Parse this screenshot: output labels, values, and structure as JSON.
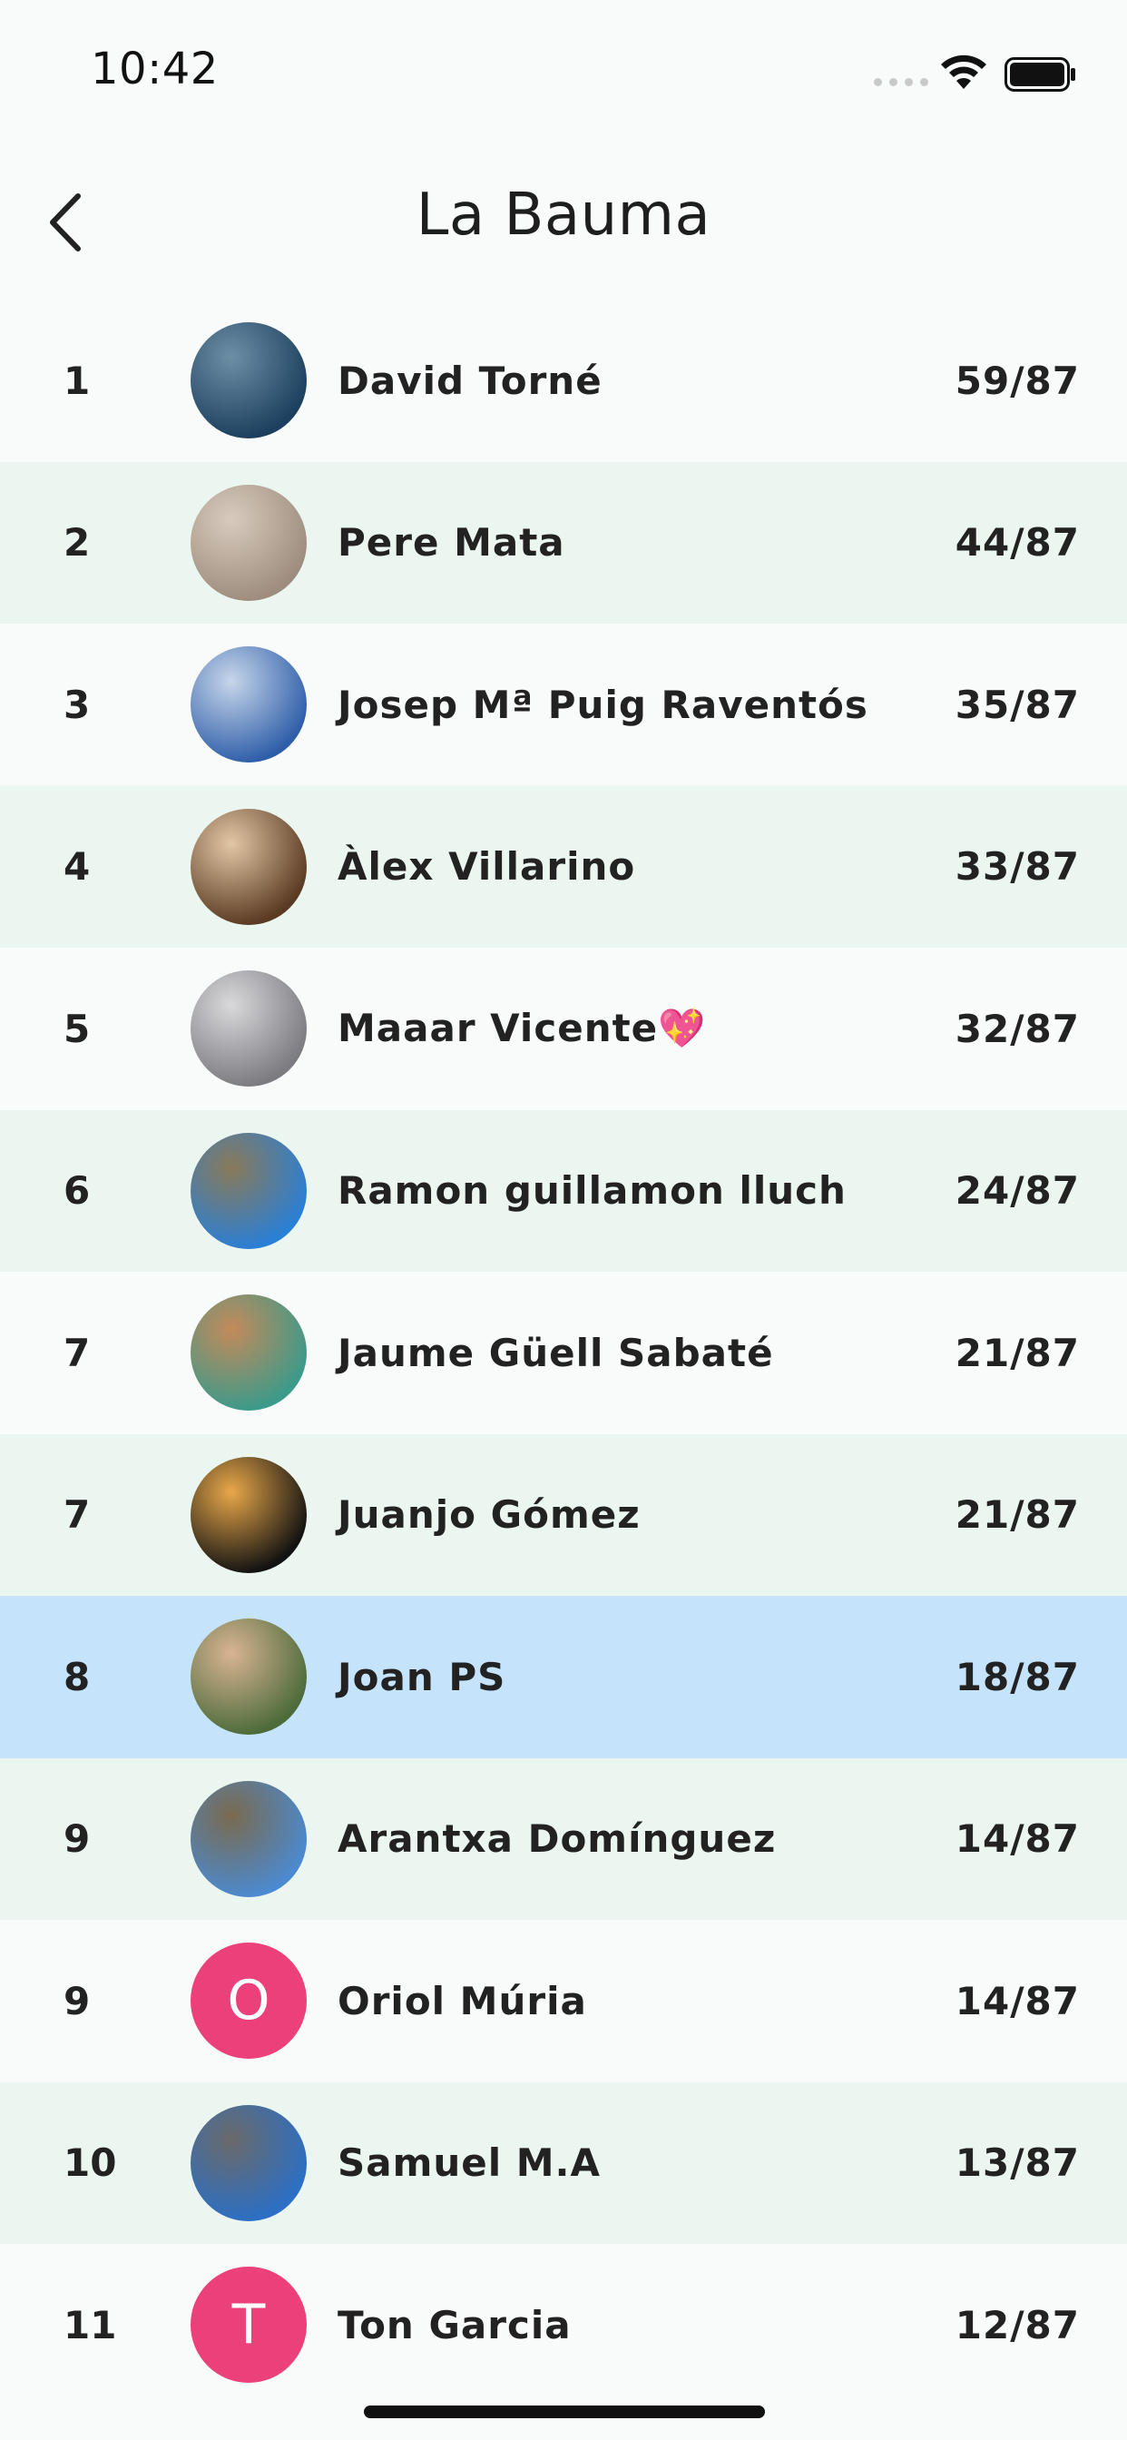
{
  "status_bar": {
    "time": "10:42"
  },
  "nav": {
    "title": "La Bauma"
  },
  "colors": {
    "avatar_letter_bg": "#ec407a",
    "highlight_row": "#c5e4fb",
    "alt_row": "#ecf6f1"
  },
  "rows": [
    {
      "rank": "1",
      "name": "David Torné",
      "score": "59/87",
      "avatar": "photo",
      "avatar_colors": [
        "#1c3f5e",
        "#6d8fa6"
      ]
    },
    {
      "rank": "2",
      "name": "Pere Mata",
      "score": "44/87",
      "avatar": "photo",
      "avatar_colors": [
        "#9e8d7e",
        "#d8cbbd"
      ]
    },
    {
      "rank": "3",
      "name": "Josep Mª Puig Raventós",
      "score": "35/87",
      "avatar": "photo",
      "avatar_colors": [
        "#2f5ea9",
        "#c7d6ea"
      ]
    },
    {
      "rank": "4",
      "name": "Àlex Villarino",
      "score": "33/87",
      "avatar": "photo",
      "avatar_colors": [
        "#5a3a22",
        "#e2c7a5"
      ]
    },
    {
      "rank": "5",
      "name": "Maaar Vicente💖",
      "score": "32/87",
      "avatar": "photo",
      "avatar_colors": [
        "#7b7b80",
        "#d9d9dc"
      ]
    },
    {
      "rank": "6",
      "name": "Ramon guillamon lluch",
      "score": "24/87",
      "avatar": "photo",
      "avatar_colors": [
        "#2a7fd6",
        "#8a7a58"
      ]
    },
    {
      "rank": "7",
      "name": "Jaume Güell Sabaté",
      "score": "21/87",
      "avatar": "photo",
      "avatar_colors": [
        "#3b9a8a",
        "#c48a5a"
      ]
    },
    {
      "rank": "7",
      "name": "Juanjo Gómez",
      "score": "21/87",
      "avatar": "photo",
      "avatar_colors": [
        "#121212",
        "#e8a84a"
      ]
    },
    {
      "rank": "8",
      "name": "Joan PS",
      "score": "18/87",
      "avatar": "photo",
      "avatar_colors": [
        "#4d6b3a",
        "#d8b493"
      ],
      "highlight": true
    },
    {
      "rank": "9",
      "name": "Arantxa Domínguez",
      "score": "14/87",
      "avatar": "photo",
      "avatar_colors": [
        "#4b8ad0",
        "#7a6a4e"
      ]
    },
    {
      "rank": "9",
      "name": "Oriol Múria",
      "score": "14/87",
      "avatar": "letter",
      "letter": "O"
    },
    {
      "rank": "10",
      "name": "Samuel M.A",
      "score": "13/87",
      "avatar": "photo",
      "avatar_colors": [
        "#2c6fc4",
        "#6a6a6a"
      ]
    },
    {
      "rank": "11",
      "name": "Ton Garcia",
      "score": "12/87",
      "avatar": "letter",
      "letter": "T"
    }
  ]
}
